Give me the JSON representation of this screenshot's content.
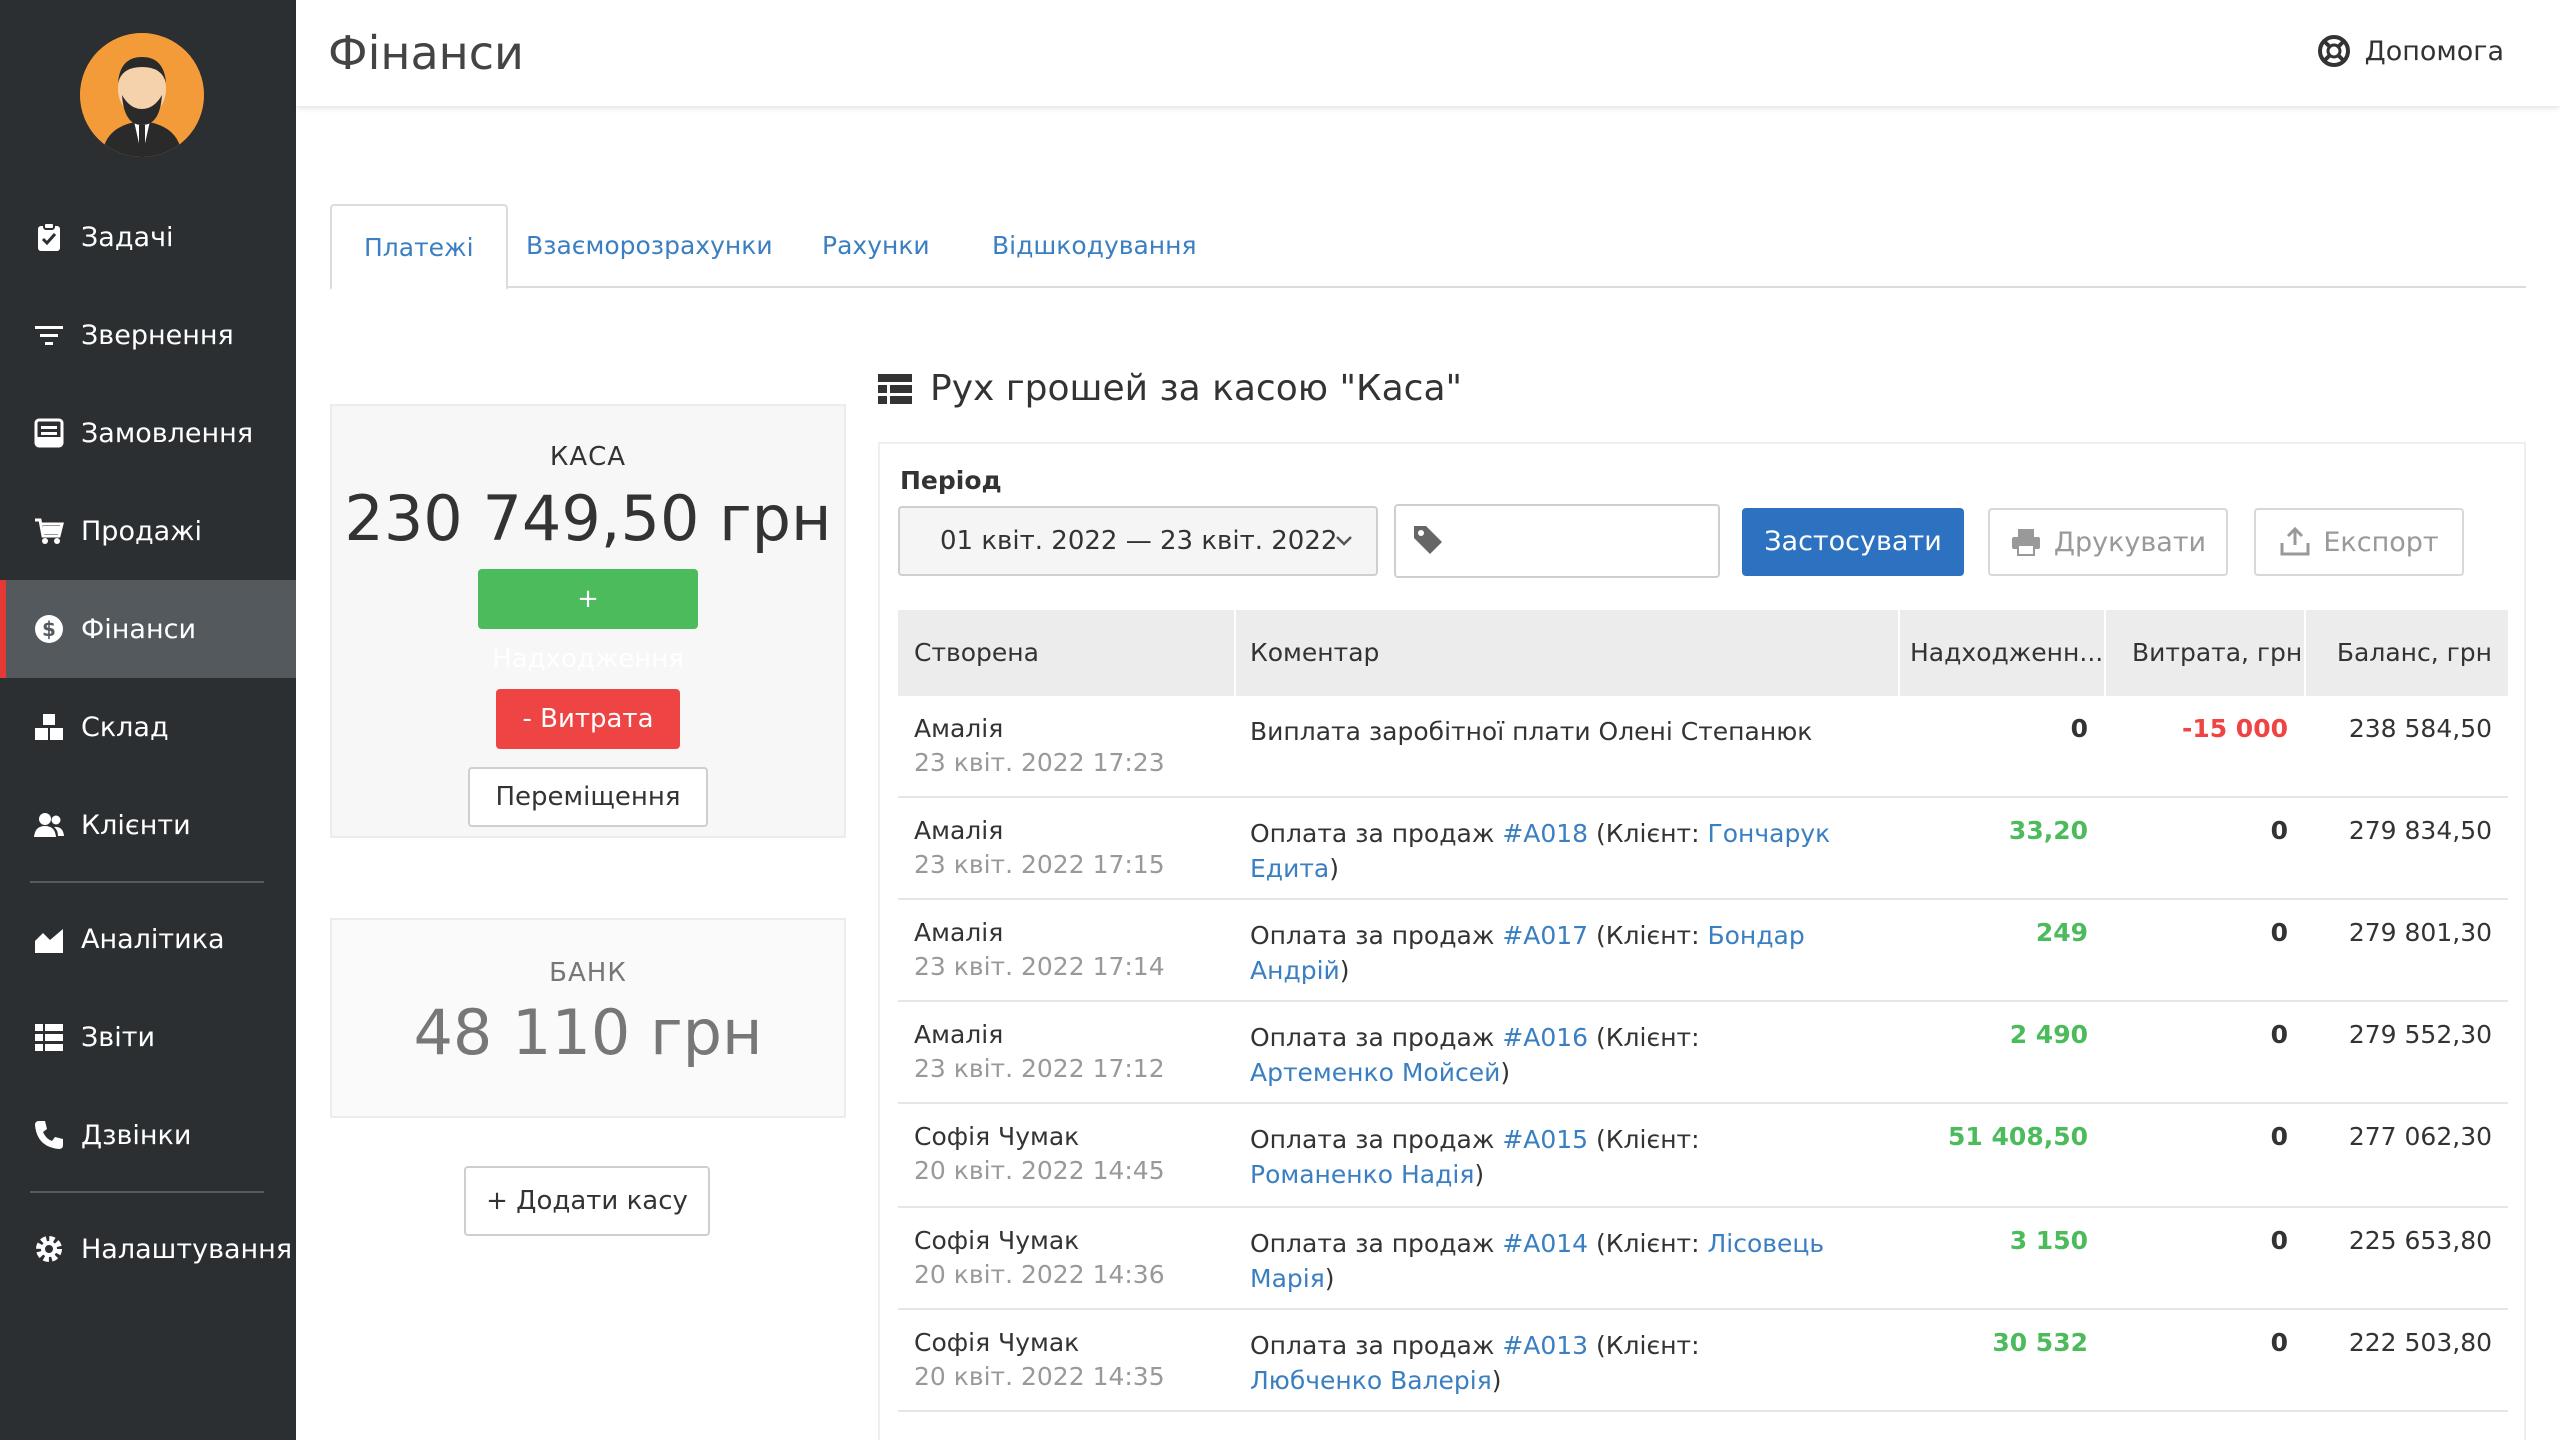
{
  "header": {
    "title": "Фінанси",
    "help_label": "Допомога"
  },
  "sidebar": {
    "items": [
      {
        "label": "Задачі",
        "icon": "clipboard-check-icon"
      },
      {
        "label": "Звернення",
        "icon": "filter-lines-icon"
      },
      {
        "label": "Замовлення",
        "icon": "order-list-icon"
      },
      {
        "label": "Продажі",
        "icon": "cart-icon"
      },
      {
        "label": "Фінанси",
        "icon": "dollar-circle-icon",
        "active": true
      },
      {
        "label": "Склад",
        "icon": "boxes-icon"
      },
      {
        "label": "Клієнти",
        "icon": "users-icon"
      },
      {
        "label": "Аналітика",
        "icon": "area-chart-icon"
      },
      {
        "label": "Звіти",
        "icon": "table-list-icon"
      },
      {
        "label": "Дзвінки",
        "icon": "phone-icon"
      },
      {
        "label": "Налаштування",
        "icon": "gear-icon"
      }
    ]
  },
  "tabs": [
    "Платежі",
    "Взаєморозрахунки",
    "Рахунки",
    "Відшкодування"
  ],
  "cash": {
    "label": "КАСА",
    "amount": "230 749,50 грн",
    "income_btn": "+ Надходження",
    "expense_btn": "- Витрата",
    "transfer_btn": "Переміщення"
  },
  "bank": {
    "label": "БАНК",
    "amount": "48 110 грн"
  },
  "add_cash_btn": "+ Додати касу",
  "section": {
    "title": "Рух грошей за касою \"Каса\""
  },
  "filter": {
    "period_label": "Період",
    "date_range": "01 квіт. 2022 — 23 квіт. 2022",
    "apply_btn": "Застосувати",
    "print_btn": "Друкувати",
    "export_btn": "Експорт"
  },
  "table": {
    "columns": [
      "Створена",
      "Коментар",
      "Надходженн...",
      "Витрата, грн",
      "Баланс, грн"
    ],
    "rows": [
      {
        "author": "Амалія",
        "date": "23 квіт. 2022 17:23",
        "comment_plain": "Виплата заробітної плати Олені Степанюк",
        "income": "0",
        "expense": "-15 000",
        "balance": "238 584,50"
      },
      {
        "author": "Амалія",
        "date": "23 квіт. 2022 17:15",
        "pre": "Оплата за продаж",
        "order": "#A018",
        "mid": "(Клієнт:",
        "client": "Гончарук Едита",
        "post": ")",
        "income": "33,20",
        "expense": "0",
        "balance": "279 834,50"
      },
      {
        "author": "Амалія",
        "date": "23 квіт. 2022 17:14",
        "pre": "Оплата за продаж",
        "order": "#A017",
        "mid": "(Клієнт:",
        "client": "Бондар Андрій",
        "post": ")",
        "income": "249",
        "expense": "0",
        "balance": "279 801,30"
      },
      {
        "author": "Амалія",
        "date": "23 квіт. 2022 17:12",
        "pre": "Оплата за продаж",
        "order": "#A016",
        "mid": "(Клієнт:",
        "client": "Артеменко Мойсей",
        "post": ")",
        "income": "2 490",
        "expense": "0",
        "balance": "279 552,30"
      },
      {
        "author": "Софія Чумак",
        "date": "20 квіт. 2022 14:45",
        "pre": "Оплата за продаж",
        "order": "#A015",
        "mid": "(Клієнт:",
        "client": "Романенко Надія",
        "post": ")",
        "income": "51 408,50",
        "expense": "0",
        "balance": "277 062,30"
      },
      {
        "author": "Софія Чумак",
        "date": "20 квіт. 2022 14:36",
        "pre": "Оплата за продаж",
        "order": "#A014",
        "mid": "(Клієнт:",
        "client": "Лісовець Марія",
        "post": ")",
        "income": "3 150",
        "expense": "0",
        "balance": "225 653,80"
      },
      {
        "author": "Софія Чумак",
        "date": "20 квіт. 2022 14:35",
        "pre": "Оплата за продаж",
        "order": "#A013",
        "mid": "(Клієнт:",
        "client": "Любченко Валерія",
        "post": ")",
        "income": "30 532",
        "expense": "0",
        "balance": "222 503,80"
      }
    ]
  }
}
